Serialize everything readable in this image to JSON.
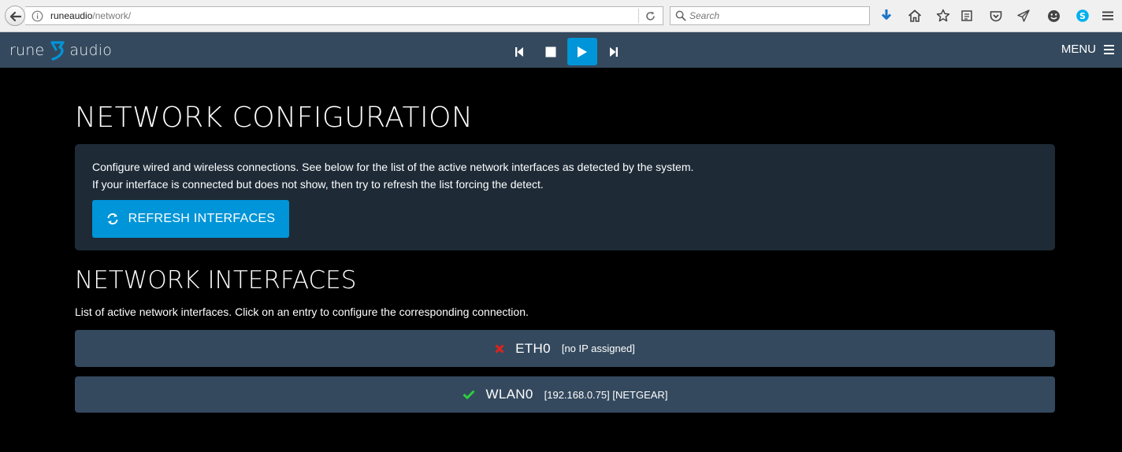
{
  "browser": {
    "url_host": "runeaudio",
    "url_path": "/network/",
    "search_placeholder": "Search"
  },
  "header": {
    "logo_left": "rune",
    "logo_right": "audio",
    "menu_label": "MENU"
  },
  "colors": {
    "accent": "#0095d8",
    "header_bg": "#34495e",
    "panel_bg": "#1e2b37",
    "error": "#e0221b",
    "success": "#2ecc40"
  },
  "network_config": {
    "title": "NETWORK CONFIGURATION",
    "description_line1": "Configure wired and wireless connections. See below for the list of the active network interfaces as detected by the system.",
    "description_line2": "If your interface is connected but does not show, then try to refresh the list forcing the detect.",
    "refresh_label": "REFRESH INTERFACES"
  },
  "network_interfaces": {
    "title": "NETWORK INTERFACES",
    "description": "List of active network interfaces. Click on an entry to configure the corresponding connection.",
    "items": [
      {
        "name": "ETH0",
        "detail": "[no IP assigned]",
        "status_icon": "x-icon"
      },
      {
        "name": "WLAN0",
        "detail": "[192.168.0.75] [NETGEAR]",
        "status_icon": "check-icon"
      }
    ]
  }
}
